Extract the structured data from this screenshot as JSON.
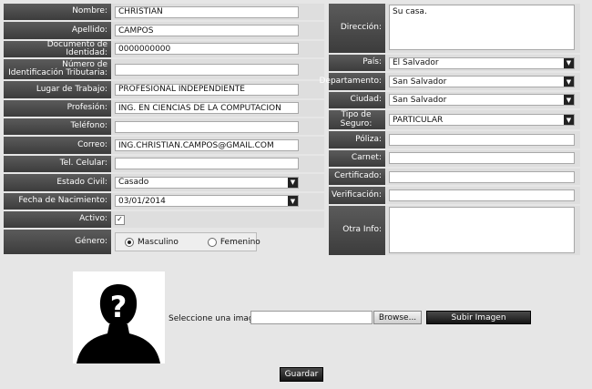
{
  "personal": {
    "nombre": {
      "label": "Nombre:",
      "value": "CHRISTIAN"
    },
    "apellido": {
      "label": "Apellido:",
      "value": "CAMPOS"
    },
    "documento": {
      "label": "Documento de Identidad:",
      "value": "0000000000"
    },
    "nit": {
      "label": "Número de Identificación Tributaria:",
      "value": ""
    },
    "lugar_trabajo": {
      "label": "Lugar de Trabajo:",
      "value": "PROFESIONAL INDEPENDIENTE"
    },
    "profesion": {
      "label": "Profesión:",
      "value": "ING. EN CIENCIAS DE LA COMPUTACION"
    },
    "telefono": {
      "label": "Teléfono:",
      "value": ""
    },
    "correo": {
      "label": "Correo:",
      "value": "ING.CHRISTIAN.CAMPOS@GMAIL.COM"
    },
    "tel_celular": {
      "label": "Tel. Celular:",
      "value": ""
    },
    "estado_civil": {
      "label": "Estado Civil:",
      "value": "Casado"
    },
    "fecha_nacimiento": {
      "label": "Fecha de Nacimiento:",
      "value": "03/01/2014"
    },
    "activo": {
      "label": "Activo:",
      "checked": true,
      "check_mark": "✓"
    },
    "genero": {
      "label": "Género:",
      "options": [
        "Masculino",
        "Femenino"
      ],
      "selected": "Masculino"
    }
  },
  "address": {
    "direccion": {
      "label": "Dirección:",
      "value": "Su casa."
    },
    "pais": {
      "label": "País:",
      "value": "El Salvador"
    },
    "departamento": {
      "label": "Departamento:",
      "value": "San Salvador"
    },
    "ciudad": {
      "label": "Ciudad:",
      "value": "San Salvador"
    },
    "tipo_seguro": {
      "label": "Tipo de Seguro:",
      "value": "PARTICULAR"
    },
    "poliza": {
      "label": "Póliza:",
      "value": ""
    },
    "carnet": {
      "label": "Carnet:",
      "value": ""
    },
    "certificado": {
      "label": "Certificado:",
      "value": ""
    },
    "verificacion": {
      "label": "Verificación:",
      "value": ""
    },
    "otra_info": {
      "label": "Otra Info:",
      "value": ""
    }
  },
  "upload": {
    "select_label": "Seleccione una imagen:",
    "browse_label": "Browse...",
    "upload_label": "Subir Imagen",
    "photo_placeholder_glyph": "?"
  },
  "actions": {
    "save_label": "Guardar"
  },
  "icons": {
    "dropdown_arrow": "▼"
  },
  "colors": {
    "label_bg": "#4a4a4a",
    "page_bg": "#e6e6e6",
    "button_dark": "#1e1e1e"
  }
}
